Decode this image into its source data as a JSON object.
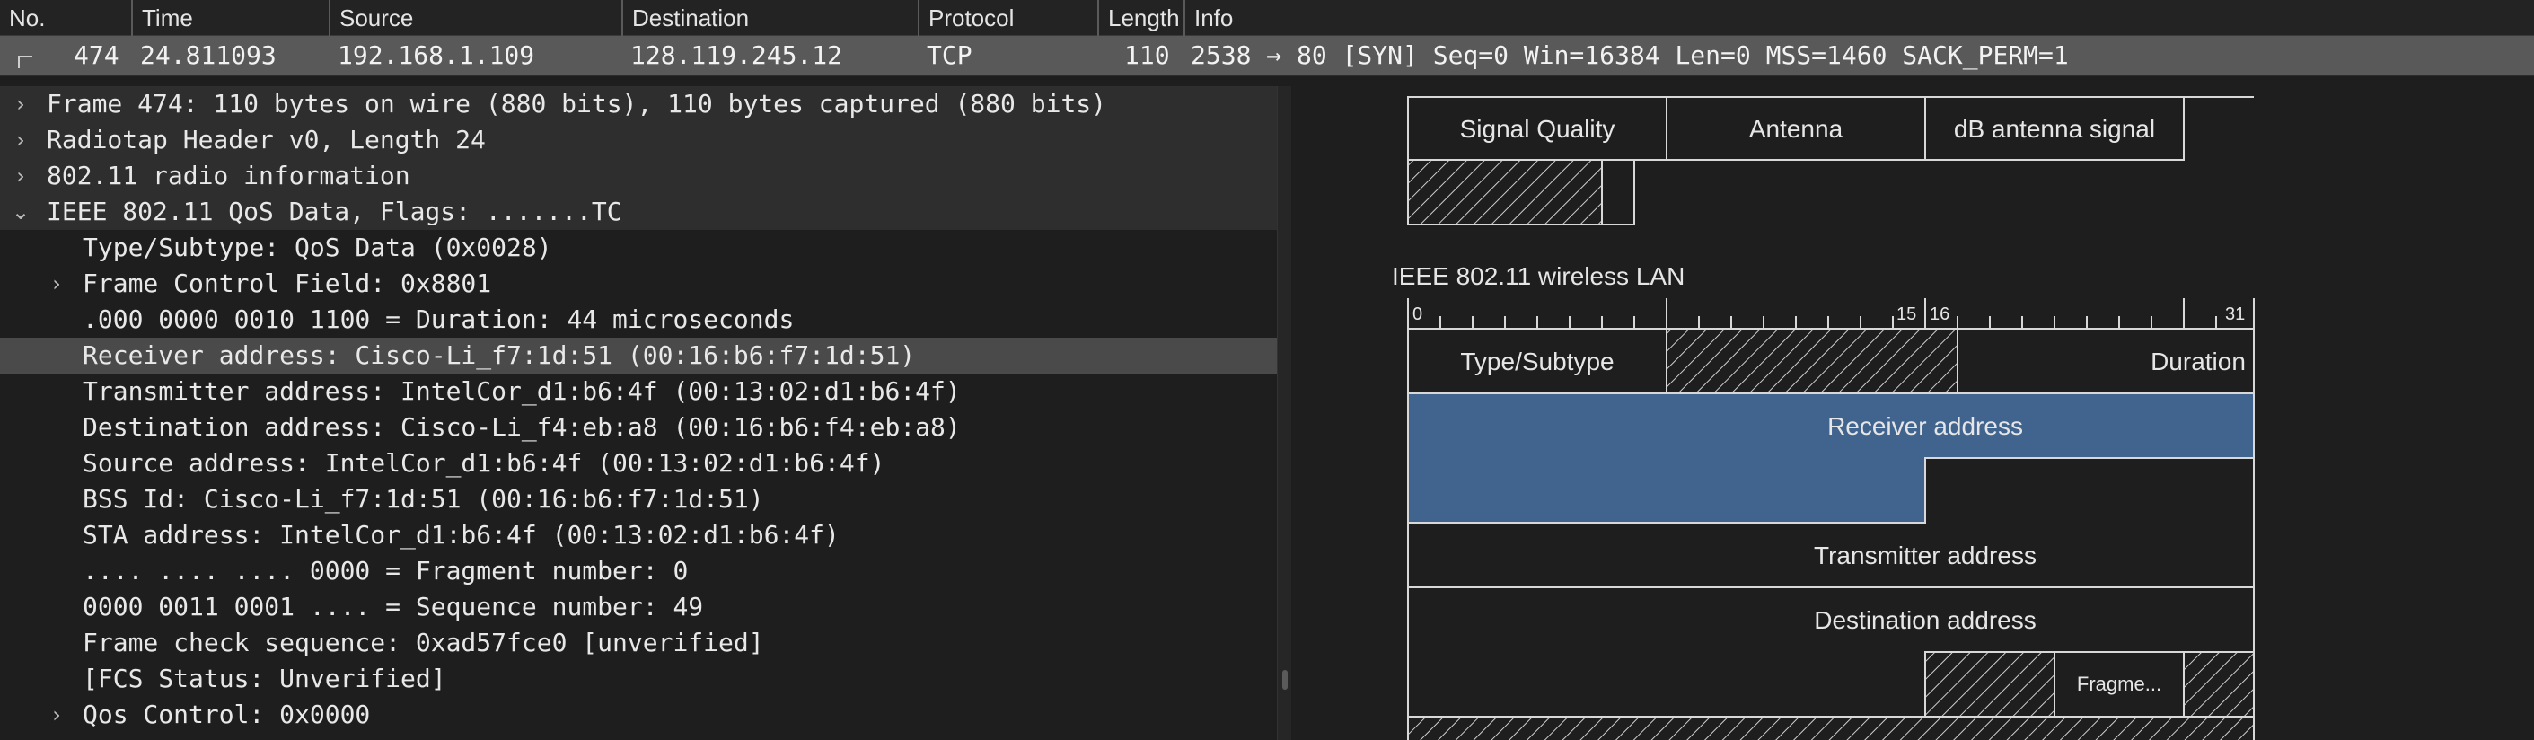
{
  "packet_list": {
    "columns": [
      "No.",
      "Time",
      "Source",
      "Destination",
      "Protocol",
      "Length",
      "Info"
    ],
    "row": {
      "no": "474",
      "time": "24.811093",
      "source": "192.168.1.109",
      "destination": "128.119.245.12",
      "protocol": "TCP",
      "length": "110",
      "info": "2538 → 80 [SYN] Seq=0 Win=16384 Len=0 MSS=1460 SACK_PERM=1"
    }
  },
  "tree": [
    {
      "text": "Frame 474: 110 bytes on wire (880 bits), 110 bytes captured (880 bits)",
      "arrow": "›"
    },
    {
      "text": "Radiotap Header v0, Length 24",
      "arrow": "›"
    },
    {
      "text": "802.11 radio information",
      "arrow": "›"
    },
    {
      "text": "IEEE 802.11 QoS Data, Flags: .......TC",
      "arrow": "⌄"
    },
    {
      "text": "Type/Subtype: QoS Data (0x0028)",
      "arrow": ""
    },
    {
      "text": "Frame Control Field: 0x8801",
      "arrow": "›"
    },
    {
      "text": ".000 0000 0010 1100 = Duration: 44 microseconds",
      "arrow": ""
    },
    {
      "text": "Receiver address: Cisco-Li_f7:1d:51 (00:16:b6:f7:1d:51)",
      "arrow": ""
    },
    {
      "text": "Transmitter address: IntelCor_d1:b6:4f (00:13:02:d1:b6:4f)",
      "arrow": ""
    },
    {
      "text": "Destination address: Cisco-Li_f4:eb:a8 (00:16:b6:f4:eb:a8)",
      "arrow": ""
    },
    {
      "text": "Source address: IntelCor_d1:b6:4f (00:13:02:d1:b6:4f)",
      "arrow": ""
    },
    {
      "text": "BSS Id: Cisco-Li_f7:1d:51 (00:16:b6:f7:1d:51)",
      "arrow": ""
    },
    {
      "text": "STA address: IntelCor_d1:b6:4f (00:13:02:d1:b6:4f)",
      "arrow": ""
    },
    {
      "text": ".... .... .... 0000 = Fragment number: 0",
      "arrow": ""
    },
    {
      "text": "0000 0011 0001 .... = Sequence number: 49",
      "arrow": ""
    },
    {
      "text": "Frame check sequence: 0xad57fce0 [unverified]",
      "arrow": ""
    },
    {
      "text": "[FCS Status: Unverified]",
      "arrow": ""
    },
    {
      "text": "Qos Control: 0x0000",
      "arrow": "›"
    }
  ],
  "diagram": {
    "radiotap_fields": [
      "Signal Quality",
      "Antenna",
      "dB antenna signal"
    ],
    "title": "IEEE 802.11 wireless LAN",
    "bit_labels": [
      "0",
      "15",
      "16",
      "31"
    ],
    "fields": {
      "type_subtype": "Type/Subtype",
      "duration": "Duration",
      "receiver": "Receiver address",
      "transmitter": "Transmitter address",
      "destination": "Destination address",
      "fragment": "Fragme..."
    },
    "colors": {
      "selected_field": "#41648f",
      "border": "#d8d8d8",
      "background": "#1e1e1e"
    }
  }
}
